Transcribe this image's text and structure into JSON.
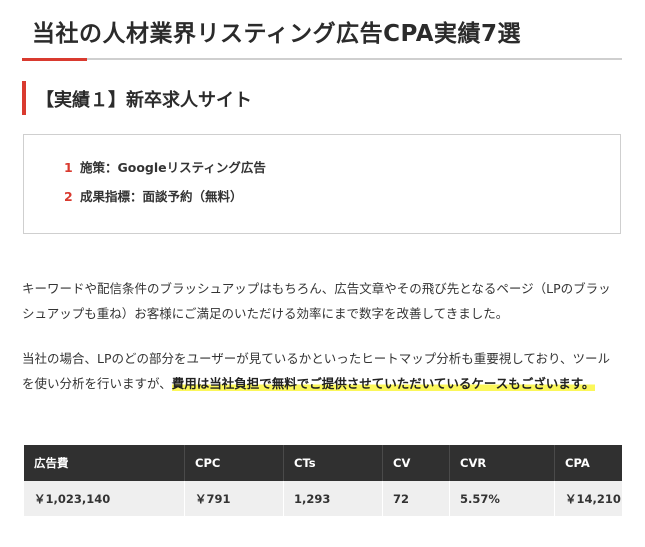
{
  "heading": {
    "title": "当社の人材業界リスティング広告CPA実績7選",
    "accent_color": "#d93a2f"
  },
  "case": {
    "title": "【実績１】新卒求人サイト",
    "items": [
      {
        "num": "1",
        "text": "施策：Googleリスティング広告"
      },
      {
        "num": "2",
        "text": "成果指標：面談予約（無料）"
      }
    ]
  },
  "paragraphs": {
    "p1": "キーワードや配信条件のブラッシュアップはもちろん、広告文章やその飛び先となるページ（LPのブラッシュアップも重ね）お客様にご満足のいただける効率にまで数字を改善してきました。",
    "p2_plain": "当社の場合、LPのどの部分をユーザーが見ているかといったヒートマップ分析も重要視しており、ツールを使い分析を行いますが、",
    "p2_highlight": "費用は当社負担で無料でご提供させていただいているケースもございます。",
    "highlight_color": "#fbf75a"
  },
  "table": {
    "headers": [
      "広告費",
      "CPC",
      "CTs",
      "CV",
      "CVR",
      "CPA"
    ],
    "rows": [
      [
        "￥1,023,140",
        "￥791",
        "1,293",
        "72",
        "5.57%",
        "￥14,210"
      ]
    ],
    "header_bg": "#303030",
    "row_bg": "#efefef"
  }
}
